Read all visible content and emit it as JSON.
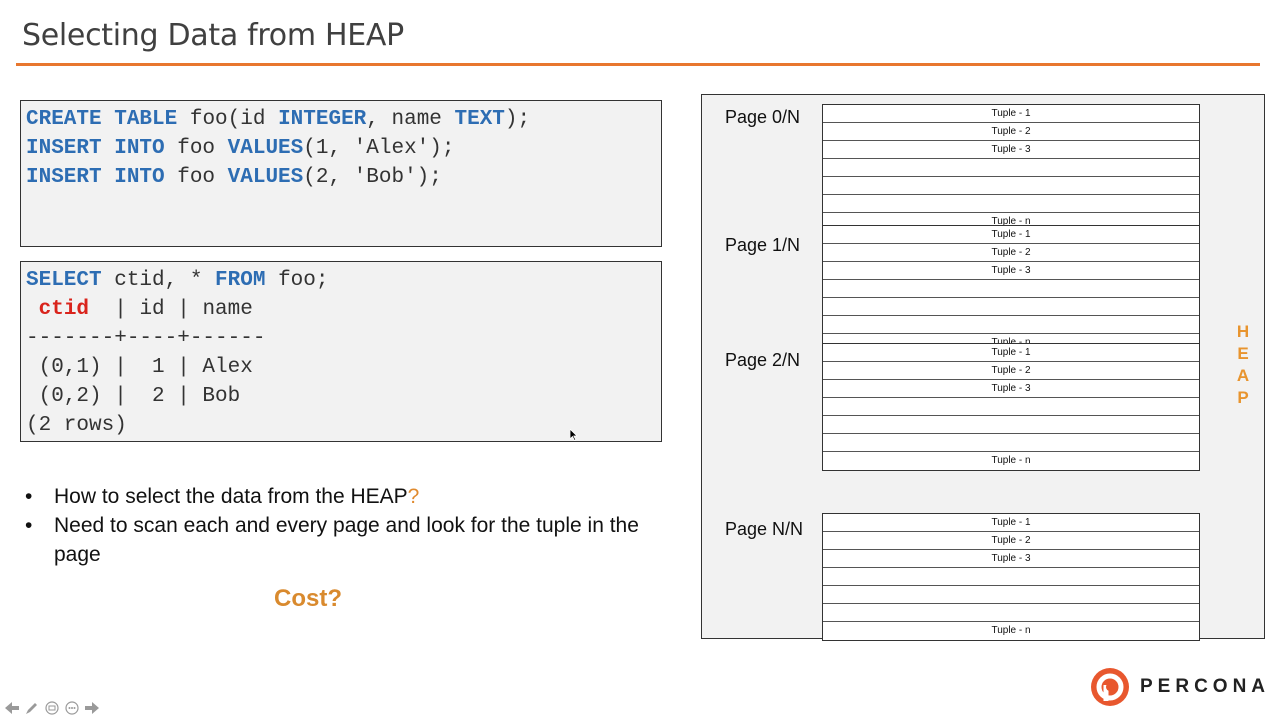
{
  "title": "Selecting Data from HEAP",
  "colors": {
    "accent": "#e8772e",
    "keyword": "#2d6db3",
    "highlight": "#d9241c",
    "orange_text": "#e08a2e",
    "heap_letters": "#e8942e"
  },
  "create_block": {
    "lines": [
      [
        {
          "t": "CREATE TABLE",
          "k": 1
        },
        {
          "t": " foo(id ",
          "k": 0
        },
        {
          "t": "INTEGER",
          "k": 1
        },
        {
          "t": ", name ",
          "k": 0
        },
        {
          "t": "TEXT",
          "k": 1
        },
        {
          "t": ");",
          "k": 0
        }
      ],
      [
        {
          "t": "INSERT INTO",
          "k": 1
        },
        {
          "t": " foo ",
          "k": 0
        },
        {
          "t": "VALUES",
          "k": 1
        },
        {
          "t": "(1, 'Alex');",
          "k": 0
        }
      ],
      [
        {
          "t": "INSERT INTO",
          "k": 1
        },
        {
          "t": " foo ",
          "k": 0
        },
        {
          "t": "VALUES",
          "k": 1
        },
        {
          "t": "(2, 'Bob');",
          "k": 0
        }
      ]
    ]
  },
  "select_block": {
    "lines": [
      [
        {
          "t": "SELECT",
          "k": 1
        },
        {
          "t": " ctid, * ",
          "k": 0
        },
        {
          "t": "FROM",
          "k": 1
        },
        {
          "t": " foo;",
          "k": 0
        }
      ],
      [
        {
          "t": " ",
          "k": 0
        },
        {
          "t": "ctid",
          "k": 2
        },
        {
          "t": "  | id | name",
          "k": 0
        }
      ],
      [
        {
          "t": "-------+----+------",
          "k": 0
        }
      ],
      [
        {
          "t": " (0,1) |  1 | Alex",
          "k": 0
        }
      ],
      [
        {
          "t": " (0,2) |  2 | Bob",
          "k": 0
        }
      ],
      [
        {
          "t": "(2 rows)",
          "k": 0
        }
      ]
    ]
  },
  "bullets": [
    {
      "text": "How to select the data from the HEAP",
      "suffix": "?"
    },
    {
      "text": "Need to scan each and every page and look for the tuple in the page",
      "suffix": ""
    }
  ],
  "bullet_marker": "•",
  "cost_label": "Cost?",
  "heap": {
    "pages": [
      {
        "label": "Page 0/N",
        "rows": [
          "Tuple - 1",
          "Tuple - 2",
          "Tuple - 3",
          "",
          "",
          "",
          "Tuple - n"
        ]
      },
      {
        "label": "Page 1/N",
        "rows": [
          "Tuple - 1",
          "Tuple - 2",
          "Tuple - 3",
          "",
          "",
          "",
          "Tuple - n"
        ]
      },
      {
        "label": "Page 2/N",
        "rows": [
          "Tuple - 1",
          "Tuple - 2",
          "Tuple - 3",
          "",
          "",
          "",
          "Tuple - n"
        ]
      },
      {
        "label": "Page N/N",
        "rows": [
          "Tuple - 1",
          "Tuple - 2",
          "Tuple - 3",
          "",
          "",
          "",
          "Tuple - n"
        ]
      }
    ],
    "side_letters": [
      "H",
      "E",
      "A",
      "P"
    ]
  },
  "logo_text": "PERCONA",
  "nav_icons": [
    "back-arrow-icon",
    "pen-icon",
    "slides-icon",
    "more-icon",
    "forward-arrow-icon"
  ]
}
